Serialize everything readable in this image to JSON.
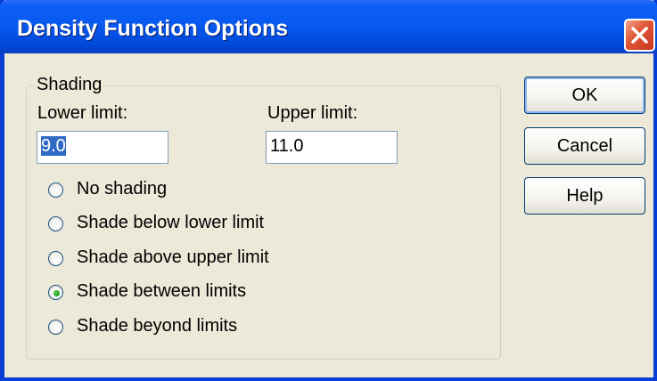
{
  "window": {
    "title": "Density Function Options"
  },
  "shading": {
    "group_label": "Shading",
    "lower_limit_label": "Lower limit:",
    "lower_limit_value": "9.0",
    "upper_limit_label": "Upper limit:",
    "upper_limit_value": "11.0",
    "options": [
      {
        "label": "No shading",
        "selected": false
      },
      {
        "label": "Shade below lower limit",
        "selected": false
      },
      {
        "label": "Shade above upper limit",
        "selected": false
      },
      {
        "label": "Shade between limits",
        "selected": true
      },
      {
        "label": "Shade beyond limits",
        "selected": false
      }
    ]
  },
  "buttons": {
    "ok": "OK",
    "cancel": "Cancel",
    "help": "Help"
  },
  "colors": {
    "titlebar": "#0758ee",
    "close_button": "#e2593a",
    "dialog_background": "#ece9d8",
    "selection": "#316ac5",
    "radio_selected_dot": "#21a121"
  }
}
